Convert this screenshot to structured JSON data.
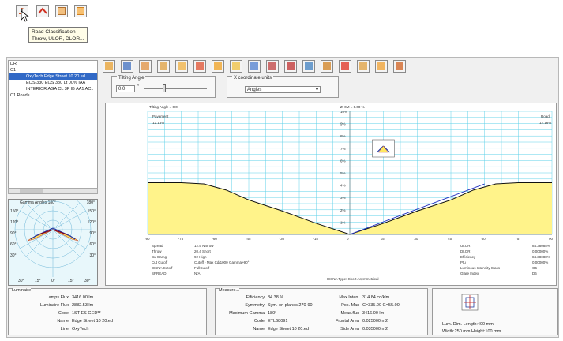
{
  "toolbar_top": {
    "icons": [
      "road-icon",
      "roof-icon",
      "table-icon",
      "grid-icon"
    ],
    "tooltip": {
      "line1": "Road Classification",
      "line2": "Throw, ULOR, DLOR..."
    }
  },
  "tree": {
    "items": [
      {
        "label": "DR",
        "indent": 0,
        "selected": false
      },
      {
        "label": "C1",
        "indent": 0,
        "selected": false
      },
      {
        "label": "OxyTech Edge Street 10 20.ed",
        "indent": 2,
        "selected": true
      },
      {
        "label": "EOS 330 EOS 330 Lt 00% IAA",
        "indent": 2,
        "selected": false
      },
      {
        "label": "INTERIOR AGA CL 3F IB AA1 AC..",
        "indent": 2,
        "selected": false
      },
      {
        "label": "C1 Roads",
        "indent": 0,
        "selected": false
      }
    ]
  },
  "polar": {
    "title": "Gamma Angles 180°",
    "top_right": "180°",
    "left_labels": [
      "150°",
      "120°",
      "90°",
      "60°",
      "30°"
    ],
    "right_labels": [
      "150°",
      "120°",
      "90°",
      "60°",
      "30°"
    ],
    "bottom_labels": [
      "30°",
      "15°",
      "0°",
      "15°",
      "30°"
    ]
  },
  "toolbar2": {
    "icons": [
      "pencil-icon",
      "table-icon",
      "camera-icon",
      "chart-icon",
      "photo-icon",
      "lamp-icon",
      "warning-icon",
      "document-icon",
      "grid-icon",
      "report-icon",
      "disk-icon",
      "polar-icon",
      "lamp-post-icon",
      "roof-icon",
      "table-icon",
      "settings-icon",
      "road-icon"
    ]
  },
  "tilting": {
    "label": "Tilting Angle",
    "value": "0.0",
    "unit": "°"
  },
  "xcoord": {
    "label": "X coordinate units",
    "value": "Angles"
  },
  "chart": {
    "header_left": "Tilting Angle = 0.0",
    "header_center": "Z: 0M = 0.00 %",
    "top_left_label": "Pavement",
    "top_left_value": "12.16%",
    "top_right_label": "Road",
    "top_right_value": "12.16%",
    "y_ticks": [
      "10%",
      "9%",
      "8%",
      "7%",
      "6%",
      "5%",
      "4%",
      "3%",
      "2%",
      "1%"
    ],
    "x_ticks": [
      "-90",
      "-75",
      "-60",
      "-45",
      "-30",
      "-15",
      "0",
      "15",
      "30",
      "45",
      "60",
      "75",
      "90"
    ],
    "info_left_keys": [
      "Spread",
      "Throw",
      "Bu Gamg",
      "Cut Cutoff",
      "IESNA Cutoff",
      "SPREAD"
    ],
    "info_left_vals": [
      "12.5  Narrow",
      "20.4  Short",
      "92  High",
      "Cutoff  -  Max Cd/1000 Gamma>90°",
      "FullCutoff",
      "N/A"
    ],
    "info_center": "IESNA Type: Short  Asymmetrical",
    "info_right_keys": [
      "ULOR",
      "DLOR",
      "Efficiency",
      "Ptu",
      "Luminous Intensity Class",
      "Glare Index"
    ],
    "info_right_vals": [
      "84.38088%",
      "0.00000%",
      "84.38088%",
      "0.00000%",
      "G6",
      "D6"
    ]
  },
  "chart_data": {
    "type": "area",
    "title": "",
    "xlabel": "",
    "ylabel": "",
    "xlim": [
      -90,
      90
    ],
    "ylim": [
      0,
      10
    ],
    "x": [
      -90,
      -75,
      -65,
      -55,
      -45,
      -30,
      -15,
      0,
      15,
      30,
      45,
      55,
      65,
      75,
      90
    ],
    "values": [
      4.2,
      4.2,
      4.1,
      3.6,
      2.8,
      1.9,
      0.9,
      0.0,
      0.9,
      1.9,
      2.8,
      3.6,
      4.1,
      4.2,
      4.2
    ],
    "grid": true
  },
  "luminaire": {
    "title": "Luminaire",
    "rows": [
      {
        "k": "Lamps Flux",
        "v": "3416.00 lm"
      },
      {
        "k": "Luminaire Flux",
        "v": "2882.53 lm"
      },
      {
        "k": "Code",
        "v": "1ST ES GED**"
      },
      {
        "k": "Name",
        "v": "Edge Street 10 20.ed"
      },
      {
        "k": "Line",
        "v": "OxyTech"
      }
    ]
  },
  "measure": {
    "title": "Measure...",
    "left": [
      {
        "k": "Efficiency",
        "v": "84.38 %"
      },
      {
        "k": "Symmetry",
        "v": "Sym. on planes 270-90"
      },
      {
        "k": "Maximum Gamma",
        "v": "180°"
      },
      {
        "k": "Code",
        "v": "ETL68091"
      },
      {
        "k": "Name",
        "v": "Edge Street 10 20.ed"
      }
    ],
    "right": [
      {
        "k": "Max Inten.",
        "v": "314.84 cd/klm"
      },
      {
        "k": "Pos. Max",
        "v": "C=335.00 G=55.00"
      },
      {
        "k": "Meas.flux",
        "v": "3416.00 lm"
      },
      {
        "k": "Frontal Area",
        "v": "0.025000 m2"
      },
      {
        "k": "Side Area",
        "v": "0.035000 m2"
      }
    ]
  },
  "dims": {
    "line1": "Lum. Dim.  Length:400 mm",
    "line2": "Width:250 mm Height:100 mm"
  }
}
